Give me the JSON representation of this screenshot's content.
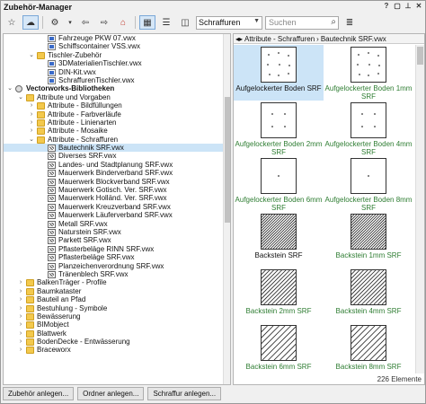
{
  "window": {
    "title": "Zubehör-Manager"
  },
  "toolbar": {
    "category": "Schraffuren",
    "search_placeholder": "Suchen"
  },
  "tree": [
    {
      "d": 3,
      "icon": "file",
      "exp": "",
      "label": "Fahrzeuge PKW 07.vwx"
    },
    {
      "d": 3,
      "icon": "file",
      "exp": "",
      "label": "Schiffscontainer VSS.vwx"
    },
    {
      "d": 2,
      "icon": "folder",
      "exp": "v",
      "label": "Tischler-Zubehör"
    },
    {
      "d": 3,
      "icon": "file",
      "exp": "",
      "label": "3DMaterialienTischler.vwx"
    },
    {
      "d": 3,
      "icon": "file",
      "exp": "",
      "label": "DIN-Kit.vwx"
    },
    {
      "d": 3,
      "icon": "file",
      "exp": "",
      "label": "SchraffurenTischler.vwx"
    },
    {
      "d": 0,
      "icon": "lib",
      "exp": "v",
      "label": "Vectorworks-Bibliotheken",
      "bold": true
    },
    {
      "d": 1,
      "icon": "folder",
      "exp": "v",
      "label": "Attribute und Vorgaben"
    },
    {
      "d": 2,
      "icon": "folder",
      "exp": ">",
      "label": "Attribute - Bildfüllungen"
    },
    {
      "d": 2,
      "icon": "folder",
      "exp": ">",
      "label": "Attribute - Farbverläufe"
    },
    {
      "d": 2,
      "icon": "folder",
      "exp": ">",
      "label": "Attribute - Linienarten"
    },
    {
      "d": 2,
      "icon": "folder",
      "exp": ">",
      "label": "Attribute - Mosaike"
    },
    {
      "d": 2,
      "icon": "folder",
      "exp": "v",
      "label": "Attribute - Schraffuren"
    },
    {
      "d": 3,
      "icon": "filex",
      "exp": "",
      "label": "Bautechnik SRF.vwx",
      "sel": true
    },
    {
      "d": 3,
      "icon": "filex",
      "exp": "",
      "label": "Diverses SRF.vwx"
    },
    {
      "d": 3,
      "icon": "filex",
      "exp": "",
      "label": "Landes- und Stadtplanung SRF.vwx"
    },
    {
      "d": 3,
      "icon": "filex",
      "exp": "",
      "label": "Mauerwerk Binderverband SRF.vwx"
    },
    {
      "d": 3,
      "icon": "filex",
      "exp": "",
      "label": "Mauerwerk Blockverband SRF.vwx"
    },
    {
      "d": 3,
      "icon": "filex",
      "exp": "",
      "label": "Mauerwerk Gotisch. Ver. SRF.vwx"
    },
    {
      "d": 3,
      "icon": "filex",
      "exp": "",
      "label": "Mauerwerk Holländ. Ver. SRF.vwx"
    },
    {
      "d": 3,
      "icon": "filex",
      "exp": "",
      "label": "Mauerwerk Kreuzverband SRF.vwx"
    },
    {
      "d": 3,
      "icon": "filex",
      "exp": "",
      "label": "Mauerwerk Läuferverband SRF.vwx"
    },
    {
      "d": 3,
      "icon": "filex",
      "exp": "",
      "label": "Metall SRF.vwx"
    },
    {
      "d": 3,
      "icon": "filex",
      "exp": "",
      "label": "Naturstein SRF.vwx"
    },
    {
      "d": 3,
      "icon": "filex",
      "exp": "",
      "label": "Parkett SRF.vwx"
    },
    {
      "d": 3,
      "icon": "filex",
      "exp": "",
      "label": "Pflasterbeläge RINN SRF.vwx"
    },
    {
      "d": 3,
      "icon": "filex",
      "exp": "",
      "label": "Pflasterbeläge SRF.vwx"
    },
    {
      "d": 3,
      "icon": "filex",
      "exp": "",
      "label": "Planzeichenverordnung SRF.vwx"
    },
    {
      "d": 3,
      "icon": "filex",
      "exp": "",
      "label": "Tränenblech SRF.vwx"
    },
    {
      "d": 1,
      "icon": "folder",
      "exp": ">",
      "label": "BalkenTräger - Profile"
    },
    {
      "d": 1,
      "icon": "folder",
      "exp": ">",
      "label": "Baumkataster"
    },
    {
      "d": 1,
      "icon": "folder",
      "exp": ">",
      "label": "Bauteil an Pfad"
    },
    {
      "d": 1,
      "icon": "folder",
      "exp": ">",
      "label": "Bestuhlung - Symbole"
    },
    {
      "d": 1,
      "icon": "folder",
      "exp": ">",
      "label": "Bewässerung"
    },
    {
      "d": 1,
      "icon": "folder",
      "exp": ">",
      "label": "BIMobject"
    },
    {
      "d": 1,
      "icon": "folder",
      "exp": ">",
      "label": "Blattwerk"
    },
    {
      "d": 1,
      "icon": "folder",
      "exp": ">",
      "label": "BodenDecke - Entwässerung"
    },
    {
      "d": 1,
      "icon": "folder",
      "exp": ">",
      "label": "Braceworx"
    }
  ],
  "breadcrumb": [
    "Attribute - Schraffuren",
    "Bautechnik SRF.vwx"
  ],
  "items": [
    {
      "caption": "Aufgelockerter Boden SRF",
      "pattern": "dots-dense",
      "selected": true
    },
    {
      "caption": "Aufgelockerter Boden 1mm SRF",
      "pattern": "dots-dense"
    },
    {
      "caption": "Aufgelockerter Boden 2mm SRF",
      "pattern": "dots-sparse"
    },
    {
      "caption": "Aufgelockerter Boden 4mm SRF",
      "pattern": "dots-sparse"
    },
    {
      "caption": "Aufgelockerter Boden 6mm SRF",
      "pattern": "dot-single"
    },
    {
      "caption": "Aufgelockerter Boden 8mm SRF",
      "pattern": "dot-single"
    },
    {
      "caption": "Backstein  SRF",
      "pattern": "hatch-dense",
      "dark": true
    },
    {
      "caption": "Backstein 1mm SRF",
      "pattern": "hatch-dense"
    },
    {
      "caption": "Backstein 2mm SRF",
      "pattern": "hatch-med"
    },
    {
      "caption": "Backstein 4mm SRF",
      "pattern": "hatch-med"
    },
    {
      "caption": "Backstein 6mm SRF",
      "pattern": "hatch-wide"
    },
    {
      "caption": "Backstein 8mm SRF",
      "pattern": "hatch-wide"
    }
  ],
  "item_count": "226 Elemente",
  "buttons": {
    "accessory_create": "Zubehör anlegen...",
    "folder_create": "Ordner anlegen...",
    "hatch_create": "Schraffur anlegen..."
  }
}
